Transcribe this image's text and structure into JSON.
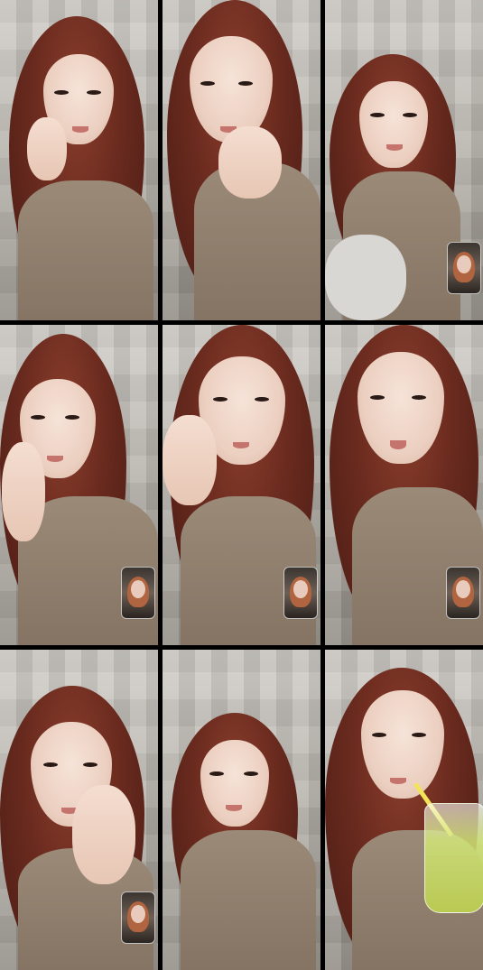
{
  "collage": {
    "tiles": [
      {
        "id": "tile-1",
        "has_pip": false
      },
      {
        "id": "tile-2",
        "has_pip": false
      },
      {
        "id": "tile-3",
        "has_pip": true
      },
      {
        "id": "tile-4",
        "has_pip": true
      },
      {
        "id": "tile-5",
        "has_pip": true
      },
      {
        "id": "tile-6",
        "has_pip": true
      },
      {
        "id": "tile-7",
        "has_pip": true
      },
      {
        "id": "tile-8",
        "has_pip": false
      },
      {
        "id": "tile-9",
        "has_pip": false
      }
    ],
    "colors": {
      "background": "#000000",
      "hair": "#6b2b1f",
      "skin": "#ecd0c1",
      "shirt": "#8f7e6c",
      "wall": "#c4c0ba"
    }
  }
}
